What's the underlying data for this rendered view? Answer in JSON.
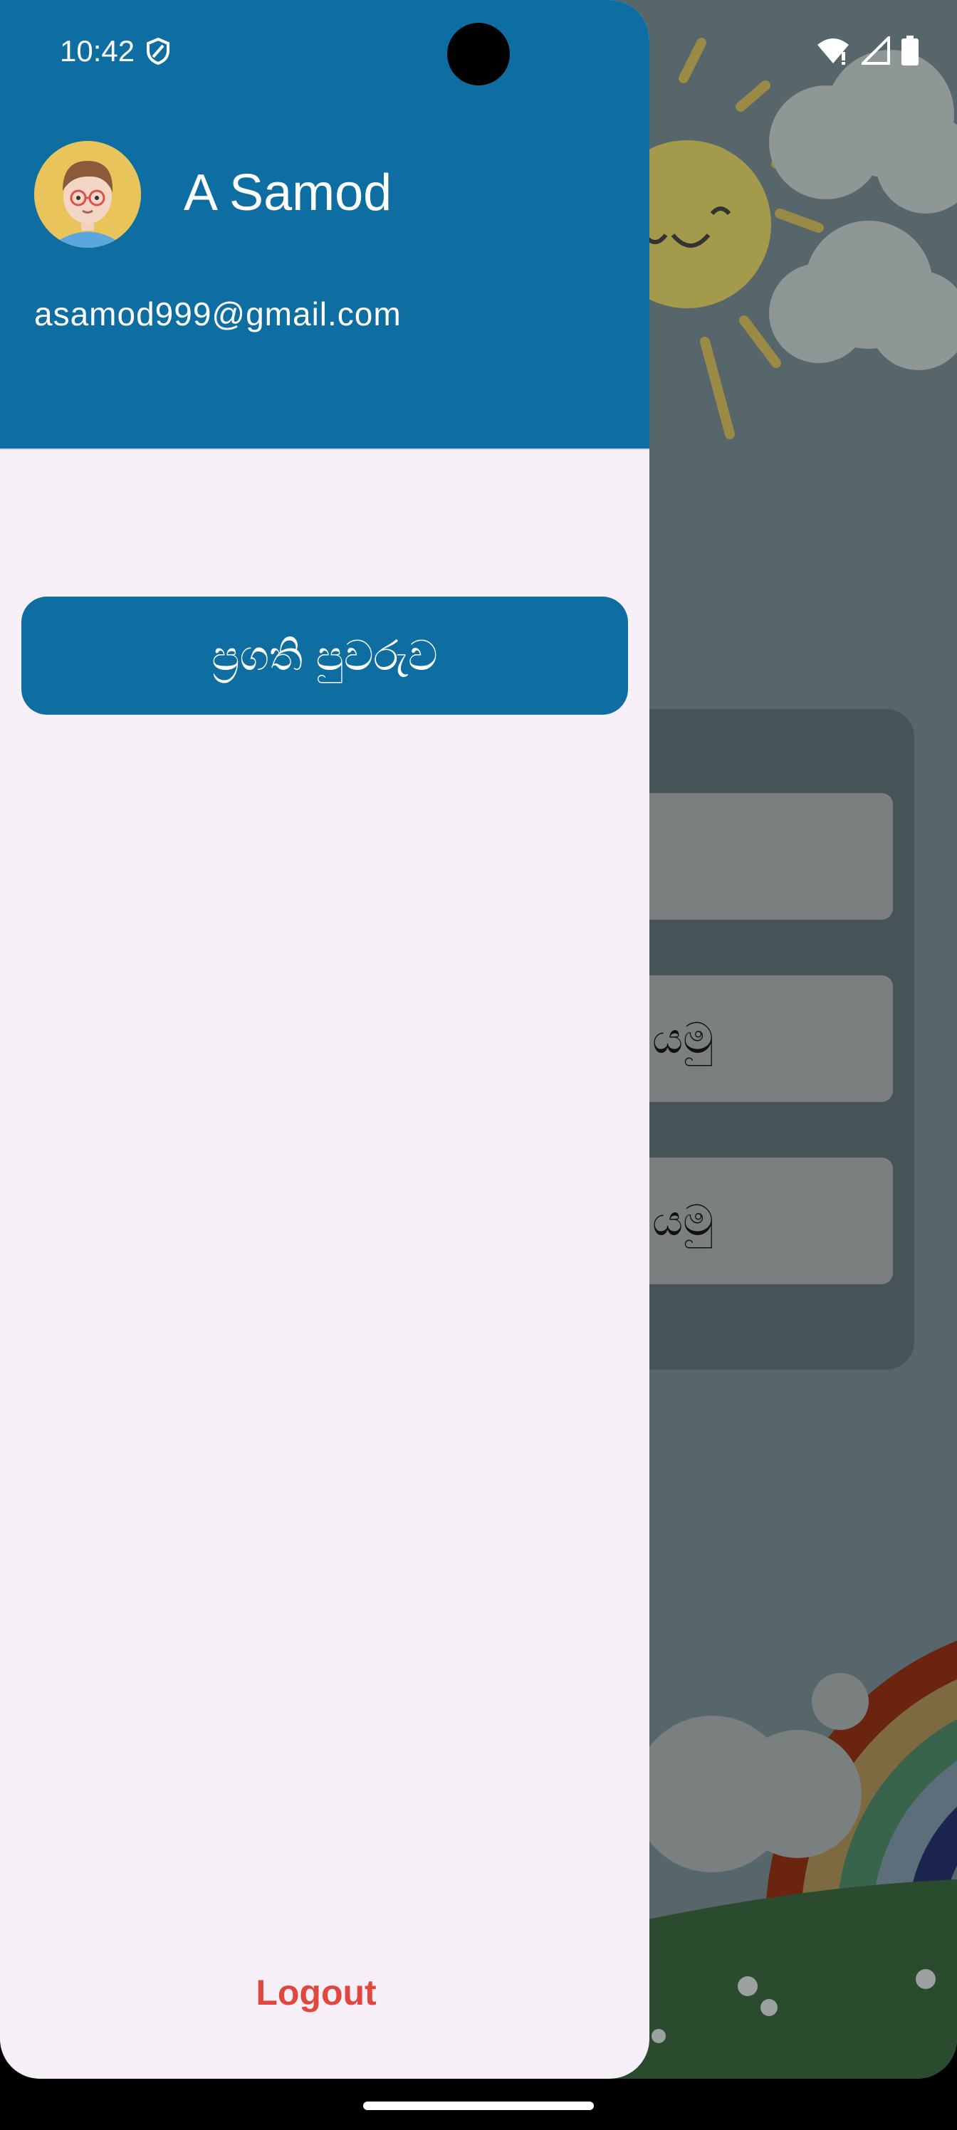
{
  "status_bar": {
    "time": "10:42"
  },
  "drawer": {
    "user_name": "A Samod",
    "user_email": "asamod999@gmail.com",
    "menu_button_label": "ප්‍රගති පුවරුව",
    "logout_label": "Logout"
  },
  "background_app": {
    "buttons": [
      {
        "label": ""
      },
      {
        "label": "යමු"
      },
      {
        "label": "යමු"
      }
    ]
  },
  "colors": {
    "primary": "#0e6ea2",
    "drawer_background": "#f6eff7",
    "logout_text": "#e0483f"
  }
}
